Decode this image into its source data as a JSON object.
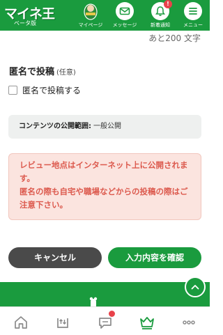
{
  "header": {
    "logo": "マイネ王",
    "logo_sub": "ベータ版",
    "nav": [
      {
        "label": "マイページ",
        "icon": "avatar-icon"
      },
      {
        "label": "メッセージ",
        "icon": "mail-icon"
      },
      {
        "label": "新着通知",
        "icon": "bell-icon",
        "badge": "!"
      },
      {
        "label": "メニュー",
        "icon": "menu-icon"
      }
    ]
  },
  "remaining_chars": "あと200 文字",
  "anonymous": {
    "title": "匿名で投稿",
    "optional": "(任意)",
    "checkbox_label": "匿名で投稿する",
    "checked": false
  },
  "scope": {
    "label": "コンテンツの公開範囲:",
    "value": "一般公開"
  },
  "warning": {
    "line1": "レビュー地点はインターネット上に公開されます。",
    "line2": "匿名の際も自宅や職場などからの投稿の際はご注意下さい。"
  },
  "buttons": {
    "cancel": "キャンセル",
    "confirm": "入力内容を確認"
  },
  "tabbar": {
    "items": [
      "home-icon",
      "upload-icon",
      "chat-icon",
      "crown-icon",
      "more-icon"
    ]
  },
  "colors": {
    "brand": "#1a9b3e",
    "warning_text": "#dc5a4e",
    "warning_bg": "#fbe4df",
    "badge": "#e8424a",
    "cancel_bg": "#4a4a4a"
  }
}
